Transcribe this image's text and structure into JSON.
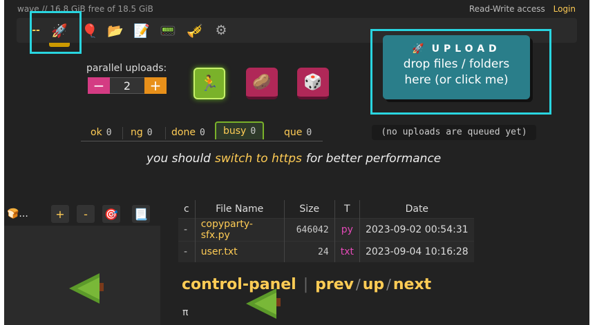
{
  "header": {
    "account_info": "wave // 16.8 GiB free of 18.5 GiB",
    "access_label": "Read-Write access",
    "login_label": "Login"
  },
  "toolbar": {
    "dash_label": "--",
    "icons": [
      "rocket-icon",
      "balloon-icon",
      "folder-icon",
      "notepad-icon",
      "keyboard-icon",
      "trumpet-icon",
      "gear-icon"
    ]
  },
  "uploader": {
    "parallel_label": "parallel uploads:",
    "minus_label": "−",
    "parallel_value": "2",
    "plus_label": "+",
    "upload_title": "UPLOAD",
    "upload_line1": "drop files / folders",
    "upload_line2": "here (or click me)",
    "queue_status": "(no uploads are queued yet)"
  },
  "tabs": [
    {
      "label": "ok",
      "count": "0"
    },
    {
      "label": "ng",
      "count": "0"
    },
    {
      "label": "done",
      "count": "0"
    },
    {
      "label": "busy",
      "count": "0"
    },
    {
      "label": "que",
      "count": "0"
    }
  ],
  "notice": {
    "before": "you should",
    "link": "switch to https",
    "after": "for better performance"
  },
  "tree": {
    "breadcrumb": "🍞...",
    "plus_label": "+",
    "minus_label": "-"
  },
  "file_table": {
    "headers": [
      "c",
      "File Name",
      "Size",
      "T",
      "Date"
    ],
    "rows": [
      {
        "c": "-",
        "name": "copyparty-sfx.py",
        "size": "646042",
        "type": "py",
        "date": "2023-09-02 00:54:31"
      },
      {
        "c": "-",
        "name": "user.txt",
        "size": "24",
        "type": "txt",
        "date": "2023-09-04 10:16:28"
      }
    ]
  },
  "footer_nav": {
    "control_panel": "control-panel",
    "separator": "|",
    "prev": "prev",
    "slash": "/",
    "up": "up",
    "next": "next",
    "pi": "π"
  },
  "colors": {
    "accent": "#ffcc55",
    "highlight": "#29d5e0",
    "upload": "#2a7e8a",
    "busy_tab": "#7ab22a",
    "file_type": "#e44ab8"
  }
}
